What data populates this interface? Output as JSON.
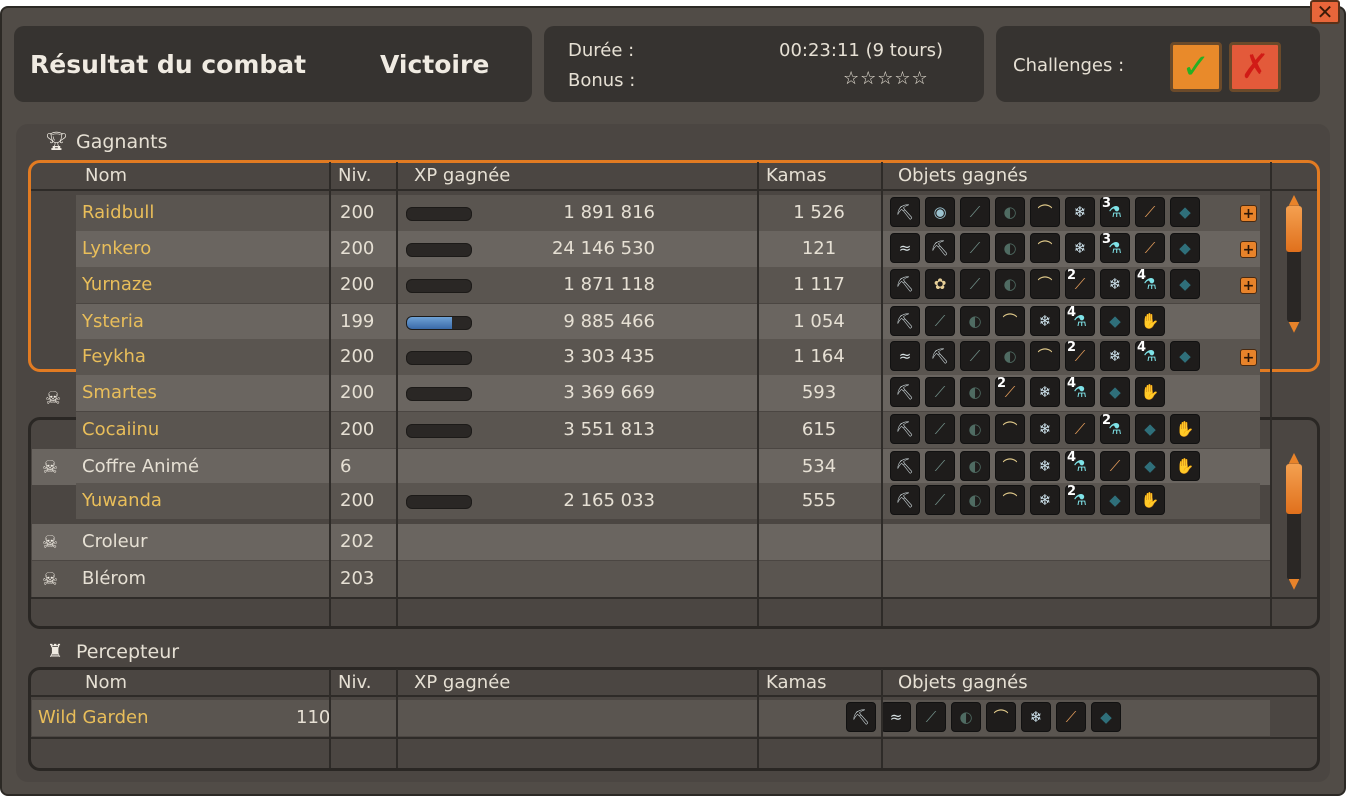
{
  "header": {
    "title": "Résultat du combat",
    "result": "Victoire",
    "duration_label": "Durée :",
    "duration_value": "00:23:11 (9 tours)",
    "bonus_label": "Bonus :",
    "bonus_stars": "☆☆☆☆☆",
    "challenges_label": "Challenges :"
  },
  "winners": {
    "title": "Gagnants"
  },
  "losers": {
    "title": ""
  },
  "collector": {
    "title": "Percepteur"
  },
  "columns": {
    "name": "Nom",
    "level": "Niv.",
    "xp": "XP gagnée",
    "kamas": "Kamas",
    "items": "Objets gagnés"
  },
  "rows": [
    {
      "name": "Raidbull",
      "level": "200",
      "xp": "1 891 816",
      "kamas": "1 526",
      "xp_fill": 0,
      "items": [
        {
          "icon": "pick-icon"
        },
        {
          "icon": "orb-icon"
        },
        {
          "icon": "bone-icon"
        },
        {
          "icon": "shell-icon"
        },
        {
          "icon": "fang-icon"
        },
        {
          "icon": "fur-icon"
        },
        {
          "icon": "potion-icon",
          "qty": "3"
        },
        {
          "icon": "candy-icon"
        },
        {
          "icon": "wing-icon"
        }
      ]
    },
    {
      "name": "Lynkero",
      "level": "200",
      "xp": "24 146 530",
      "kamas": "121",
      "xp_fill": 0,
      "items": [
        {
          "icon": "feather-icon"
        },
        {
          "icon": "pick-icon"
        },
        {
          "icon": "bone-icon"
        },
        {
          "icon": "shell-icon"
        },
        {
          "icon": "fang-icon"
        },
        {
          "icon": "fur-icon"
        },
        {
          "icon": "potion-icon",
          "qty": "3"
        },
        {
          "icon": "candy-icon"
        },
        {
          "icon": "wing-icon"
        }
      ]
    },
    {
      "name": "Yurnaze",
      "level": "200",
      "xp": "1 871 118",
      "kamas": "1 117",
      "xp_fill": 0,
      "items": [
        {
          "icon": "pick-icon"
        },
        {
          "icon": "leaf-icon"
        },
        {
          "icon": "bone-icon"
        },
        {
          "icon": "shell-icon"
        },
        {
          "icon": "fang-icon"
        },
        {
          "icon": "candy-icon",
          "qty": "2"
        },
        {
          "icon": "fur-icon"
        },
        {
          "icon": "potion-icon",
          "qty": "4"
        },
        {
          "icon": "wing-icon"
        }
      ]
    },
    {
      "name": "Ysteria",
      "level": "199",
      "xp": "9 885 466",
      "kamas": "1 054",
      "xp_fill": 0.7,
      "items": [
        {
          "icon": "pick-icon"
        },
        {
          "icon": "bone-icon"
        },
        {
          "icon": "shell-icon"
        },
        {
          "icon": "fang-icon"
        },
        {
          "icon": "fur-icon"
        },
        {
          "icon": "potion-icon",
          "qty": "4"
        },
        {
          "icon": "wing-icon"
        },
        {
          "icon": "claw-icon"
        }
      ]
    },
    {
      "name": "Feykha",
      "level": "200",
      "xp": "3 303 435",
      "kamas": "1 164",
      "xp_fill": 0,
      "items": [
        {
          "icon": "feather-icon"
        },
        {
          "icon": "pick-icon"
        },
        {
          "icon": "bone-icon"
        },
        {
          "icon": "shell-icon"
        },
        {
          "icon": "fang-icon"
        },
        {
          "icon": "candy-icon",
          "qty": "2"
        },
        {
          "icon": "fur-icon"
        },
        {
          "icon": "potion-icon",
          "qty": "4"
        },
        {
          "icon": "wing-icon"
        }
      ]
    },
    {
      "name": "Smartes",
      "level": "200",
      "xp": "3 369 669",
      "kamas": "593",
      "xp_fill": 0,
      "items": [
        {
          "icon": "pick-icon"
        },
        {
          "icon": "bone-icon"
        },
        {
          "icon": "shell-icon"
        },
        {
          "icon": "candy-icon",
          "qty": "2"
        },
        {
          "icon": "fur-icon"
        },
        {
          "icon": "potion-icon",
          "qty": "4"
        },
        {
          "icon": "wing-icon"
        },
        {
          "icon": "claw-icon"
        }
      ]
    },
    {
      "name": "Cocaiinu",
      "level": "200",
      "xp": "3 551 813",
      "kamas": "615",
      "xp_fill": 0,
      "items": [
        {
          "icon": "pick-icon"
        },
        {
          "icon": "bone-icon"
        },
        {
          "icon": "shell-icon"
        },
        {
          "icon": "fang-icon"
        },
        {
          "icon": "fur-icon"
        },
        {
          "icon": "candy-icon"
        },
        {
          "icon": "potion-icon",
          "qty": "2"
        },
        {
          "icon": "wing-icon"
        },
        {
          "icon": "claw-icon"
        }
      ]
    },
    {
      "name": "Coffre Animé",
      "level": "6",
      "xp": "",
      "kamas": "534",
      "monster": true,
      "items": [
        {
          "icon": "pick-icon"
        },
        {
          "icon": "bone-icon"
        },
        {
          "icon": "shell-icon"
        },
        {
          "icon": "fang-icon"
        },
        {
          "icon": "fur-icon"
        },
        {
          "icon": "potion-icon",
          "qty": "4"
        },
        {
          "icon": "candy-icon"
        },
        {
          "icon": "wing-icon"
        },
        {
          "icon": "claw-icon"
        }
      ]
    },
    {
      "name": "Yuwanda",
      "level": "200",
      "xp": "2 165 033",
      "kamas": "555",
      "xp_fill": 0,
      "items": [
        {
          "icon": "pick-icon"
        },
        {
          "icon": "bone-icon"
        },
        {
          "icon": "shell-icon"
        },
        {
          "icon": "fang-icon"
        },
        {
          "icon": "fur-icon"
        },
        {
          "icon": "potion-icon",
          "qty": "2"
        },
        {
          "icon": "wing-icon"
        },
        {
          "icon": "claw-icon"
        }
      ]
    },
    {
      "name": "Croleur",
      "level": "202",
      "xp": "",
      "kamas": "",
      "monster": true,
      "items": []
    },
    {
      "name": "Blérom",
      "level": "203",
      "xp": "",
      "kamas": "",
      "monster": true,
      "items": []
    }
  ],
  "collector_rows": [
    {
      "name": "Wild Garden",
      "level": "110",
      "xp": "",
      "kamas": "",
      "items": [
        {
          "icon": "pick-icon"
        },
        {
          "icon": "feather-icon"
        },
        {
          "icon": "bone-icon"
        },
        {
          "icon": "shell-icon"
        },
        {
          "icon": "fang-icon"
        },
        {
          "icon": "fur-icon"
        },
        {
          "icon": "candy-icon"
        },
        {
          "icon": "wing-icon"
        }
      ]
    }
  ],
  "colors": {
    "player_name": "#e9be5a",
    "accent": "#e27b22"
  }
}
